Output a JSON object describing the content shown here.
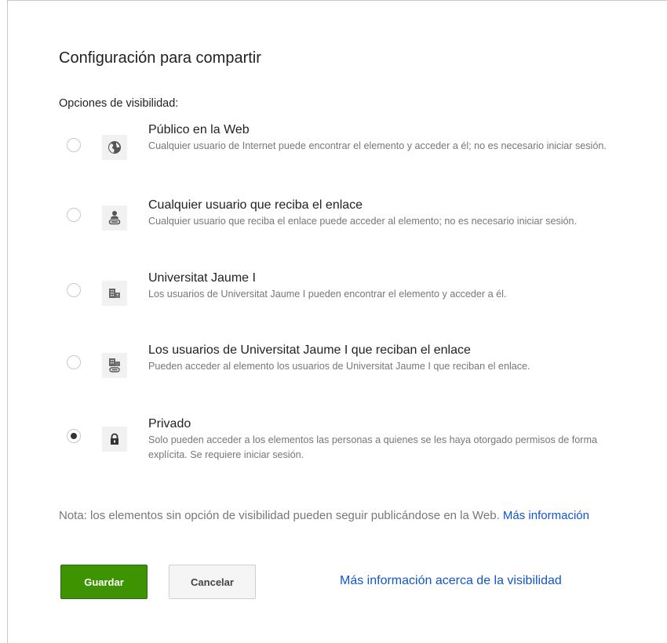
{
  "dialog": {
    "title": "Configuración para compartir",
    "section_label": "Opciones de visibilidad:",
    "options": [
      {
        "title": "Público en la Web",
        "description": "Cualquier usuario de Internet puede encontrar el elemento y acceder a él; no es necesario iniciar sesión.",
        "icon": "globe-icon",
        "checked": false
      },
      {
        "title": "Cualquier usuario que reciba el enlace",
        "description": "Cualquier usuario que reciba el enlace puede acceder al elemento; no es necesario iniciar sesión.",
        "icon": "person-link-icon",
        "checked": false
      },
      {
        "title": "Universitat Jaume I",
        "description": "Los usuarios de Universitat Jaume I pueden encontrar el elemento y acceder a él.",
        "icon": "building-icon",
        "checked": false
      },
      {
        "title": "Los usuarios de Universitat Jaume I que reciban el enlace",
        "description": "Pueden acceder al elemento los usuarios de Universitat Jaume I que reciban el enlace.",
        "icon": "building-link-icon",
        "checked": false
      },
      {
        "title": "Privado",
        "description": "Solo pueden acceder a los elementos las personas a quienes se les haya otorgado permisos de forma explícita. Se requiere iniciar sesión.",
        "icon": "lock-icon",
        "checked": true
      }
    ],
    "note_text": "Nota: los elementos sin opción de visibilidad pueden seguir publicándose en la Web.",
    "note_link": "Más información",
    "save_label": "Guardar",
    "cancel_label": "Cancelar",
    "visibility_link": "Más información acerca de la visibilidad"
  },
  "colors": {
    "save_button": "#3d9400",
    "link": "#1155cc",
    "description_text": "#777777"
  }
}
